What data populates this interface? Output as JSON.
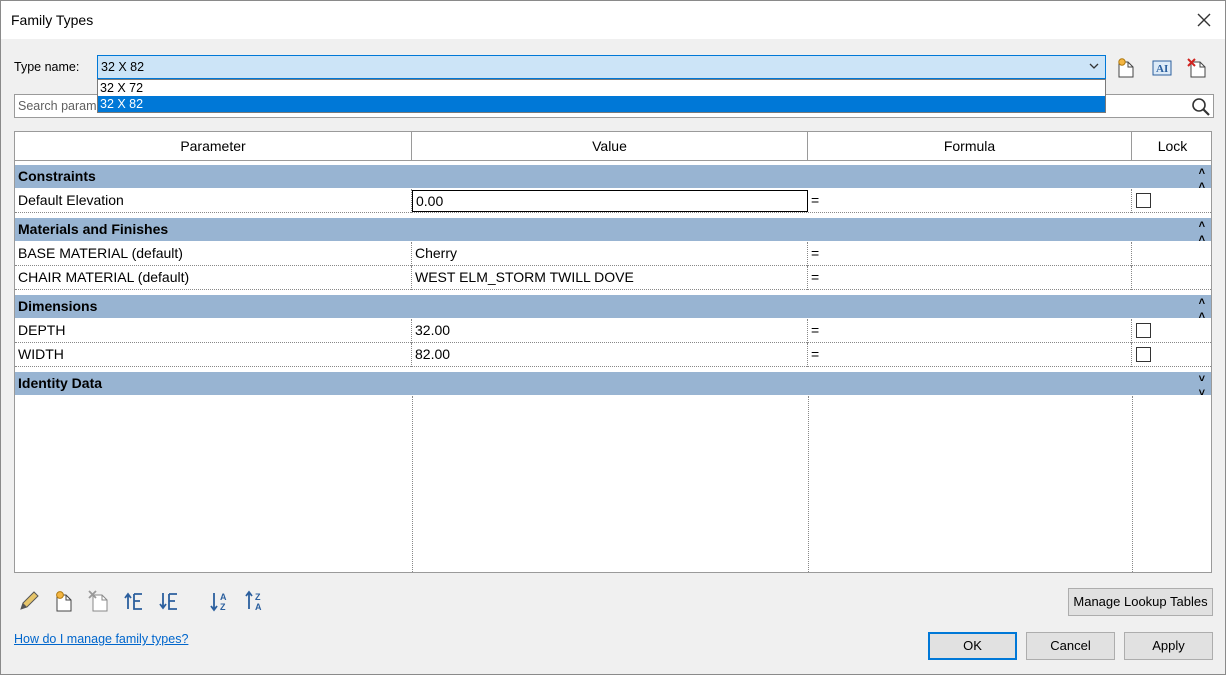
{
  "window": {
    "title": "Family Types"
  },
  "type_name": {
    "label": "Type name:",
    "value": "32 X 82",
    "options": [
      "32 X 72",
      "32 X 82"
    ],
    "selected": "32 X 82"
  },
  "search": {
    "placeholder": "Search param"
  },
  "table": {
    "headers": [
      "Parameter",
      "Value",
      "Formula",
      "Lock"
    ],
    "groups": [
      {
        "name": "Constraints",
        "rows": [
          {
            "parameter": "Default Elevation",
            "value": "0.00",
            "formula": "=",
            "lock": false
          }
        ]
      },
      {
        "name": "Materials and Finishes",
        "rows": [
          {
            "parameter": "BASE MATERIAL (default)",
            "value": "Cherry",
            "formula": "="
          },
          {
            "parameter": "CHAIR MATERIAL (default)",
            "value": "WEST ELM_STORM TWILL DOVE",
            "formula": "="
          }
        ]
      },
      {
        "name": "Dimensions",
        "rows": [
          {
            "parameter": "DEPTH",
            "value": "32.00",
            "formula": "=",
            "lock": false
          },
          {
            "parameter": "WIDTH",
            "value": "82.00",
            "formula": "=",
            "lock": false
          }
        ]
      },
      {
        "name": "Identity Data",
        "collapsed": true,
        "rows": []
      }
    ]
  },
  "buttons": {
    "manage_lookup": "Manage Lookup Tables",
    "ok": "OK",
    "cancel": "Cancel",
    "apply": "Apply"
  },
  "help_link": "How do I manage family types?",
  "icons": {
    "toolbar": [
      "new-type-icon",
      "rename-type-icon",
      "delete-type-icon"
    ],
    "bottom": [
      "edit-parameter-icon",
      "new-parameter-icon",
      "delete-parameter-icon",
      "move-up-icon",
      "move-down-icon",
      "sort-ascending-icon",
      "sort-descending-icon"
    ]
  },
  "colors": {
    "accent": "#0078d7",
    "group_header": "#98b4d2",
    "selection": "#cce4f7",
    "link": "#0066cc"
  }
}
